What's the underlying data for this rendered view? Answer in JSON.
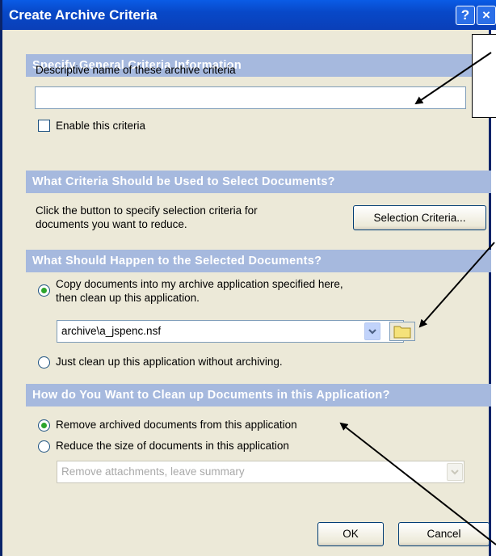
{
  "window": {
    "title": "Create Archive Criteria",
    "help_glyph": "?",
    "close_glyph": "×"
  },
  "general": {
    "header": "Specify General Criteria Information",
    "name_label": "Descriptive name of these archive criteria",
    "name_value": "",
    "enable_label": "Enable this criteria",
    "enable_checked": false
  },
  "select": {
    "header": "What Criteria Should be Used to Select Documents?",
    "description_line1": "Click the button to specify selection criteria for",
    "description_line2": "documents you want to reduce.",
    "button_label": "Selection Criteria..."
  },
  "happen": {
    "header": "What Should Happen to the Selected Documents?",
    "copy_line1": "Copy documents into my archive application specified here,",
    "copy_line2": "then clean up this application.",
    "copy_selected": true,
    "archive_path": "archive\\a_jspenc.nsf",
    "just_clean_label": "Just clean up this application without archiving.",
    "just_clean_selected": false
  },
  "cleanup": {
    "header": "How do You Want to Clean up Documents in this Application?",
    "remove_label": "Remove archived documents from this application",
    "remove_selected": true,
    "reduce_label": "Reduce the size of documents in this application",
    "reduce_selected": false,
    "reduce_option": "Remove attachments, leave summary"
  },
  "footer": {
    "ok_label": "OK",
    "cancel_label": "Cancel"
  },
  "colors": {
    "titlebar": "#0a5ce6",
    "section_header": "#a6b9de",
    "dialog_bg": "#ece9d8",
    "radio_dot": "#2ca52c"
  }
}
